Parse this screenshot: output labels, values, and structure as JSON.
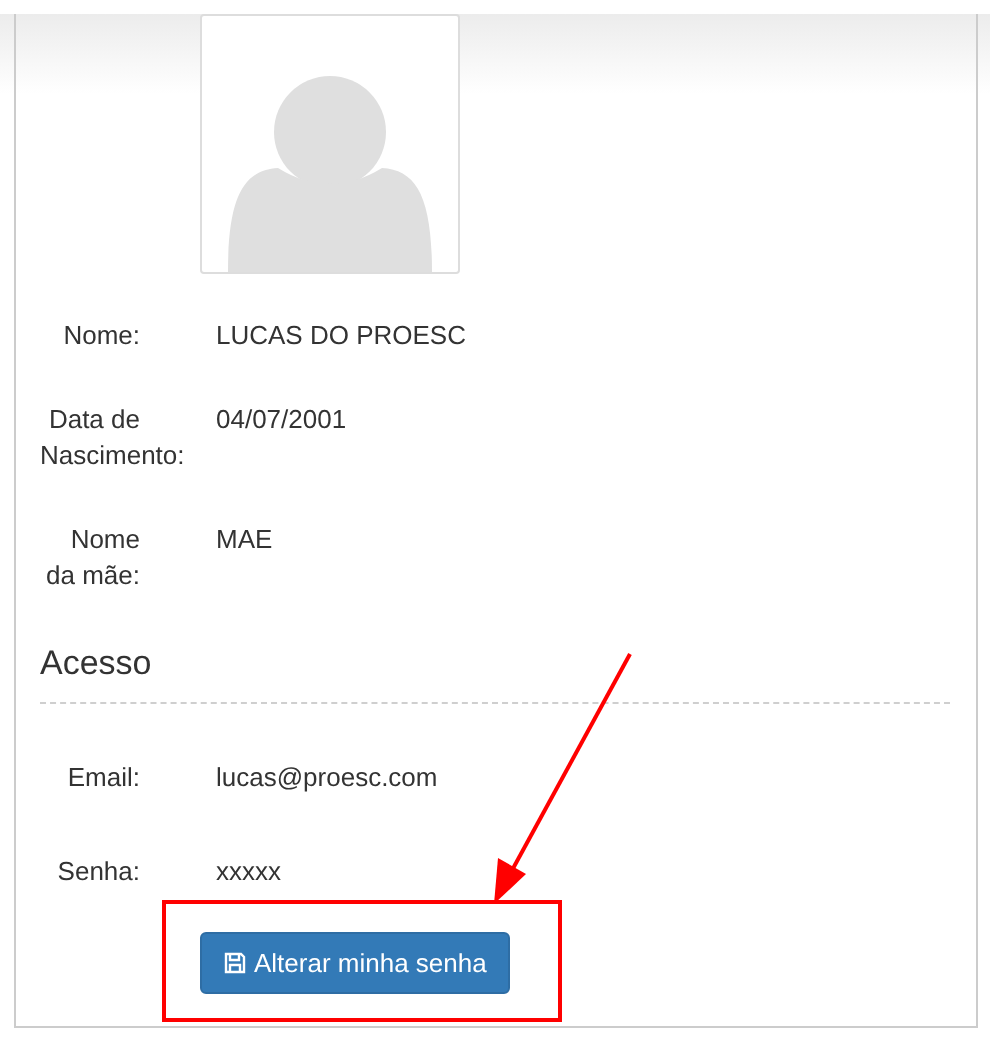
{
  "profile_fields": [
    {
      "label": "Nome:",
      "value": "LUCAS DO PROESC"
    },
    {
      "label": "Data de Nascimento:",
      "value": "04/07/2001"
    },
    {
      "label": "Nome da mãe:",
      "value": "MAE"
    }
  ],
  "access_section": {
    "title": "Acesso",
    "fields": [
      {
        "label": "Email:",
        "value": "lucas@proesc.com"
      },
      {
        "label": "Senha:",
        "value": "xxxxx"
      }
    ],
    "button": {
      "label": "Alterar minha senha"
    }
  }
}
